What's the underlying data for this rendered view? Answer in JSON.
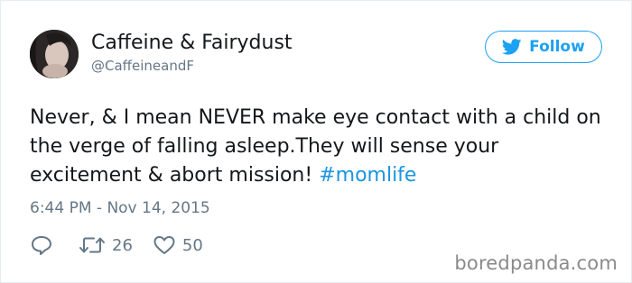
{
  "tweet": {
    "author": {
      "display_name": "Caffeine & Fairydust",
      "handle": "@CaffeineandF"
    },
    "follow_button": {
      "label": "Follow",
      "icon": "twitter-bird-icon",
      "color": "#1da1f2"
    },
    "text": "Never, & I mean NEVER make eye contact with a child on the verge of falling asleep.They will sense your excitement & abort mission! ",
    "hashtag": "#momlife",
    "timestamp": "6:44 PM - Nov 14, 2015",
    "actions": {
      "reply": {
        "icon": "reply-icon"
      },
      "retweet": {
        "icon": "retweet-icon",
        "count": "26"
      },
      "like": {
        "icon": "heart-icon",
        "count": "50"
      }
    }
  },
  "watermark": "boredpanda.com",
  "colors": {
    "text": "#14171a",
    "secondary": "#657786",
    "accent": "#1da1f2",
    "hashtag": "#1b95e0"
  }
}
